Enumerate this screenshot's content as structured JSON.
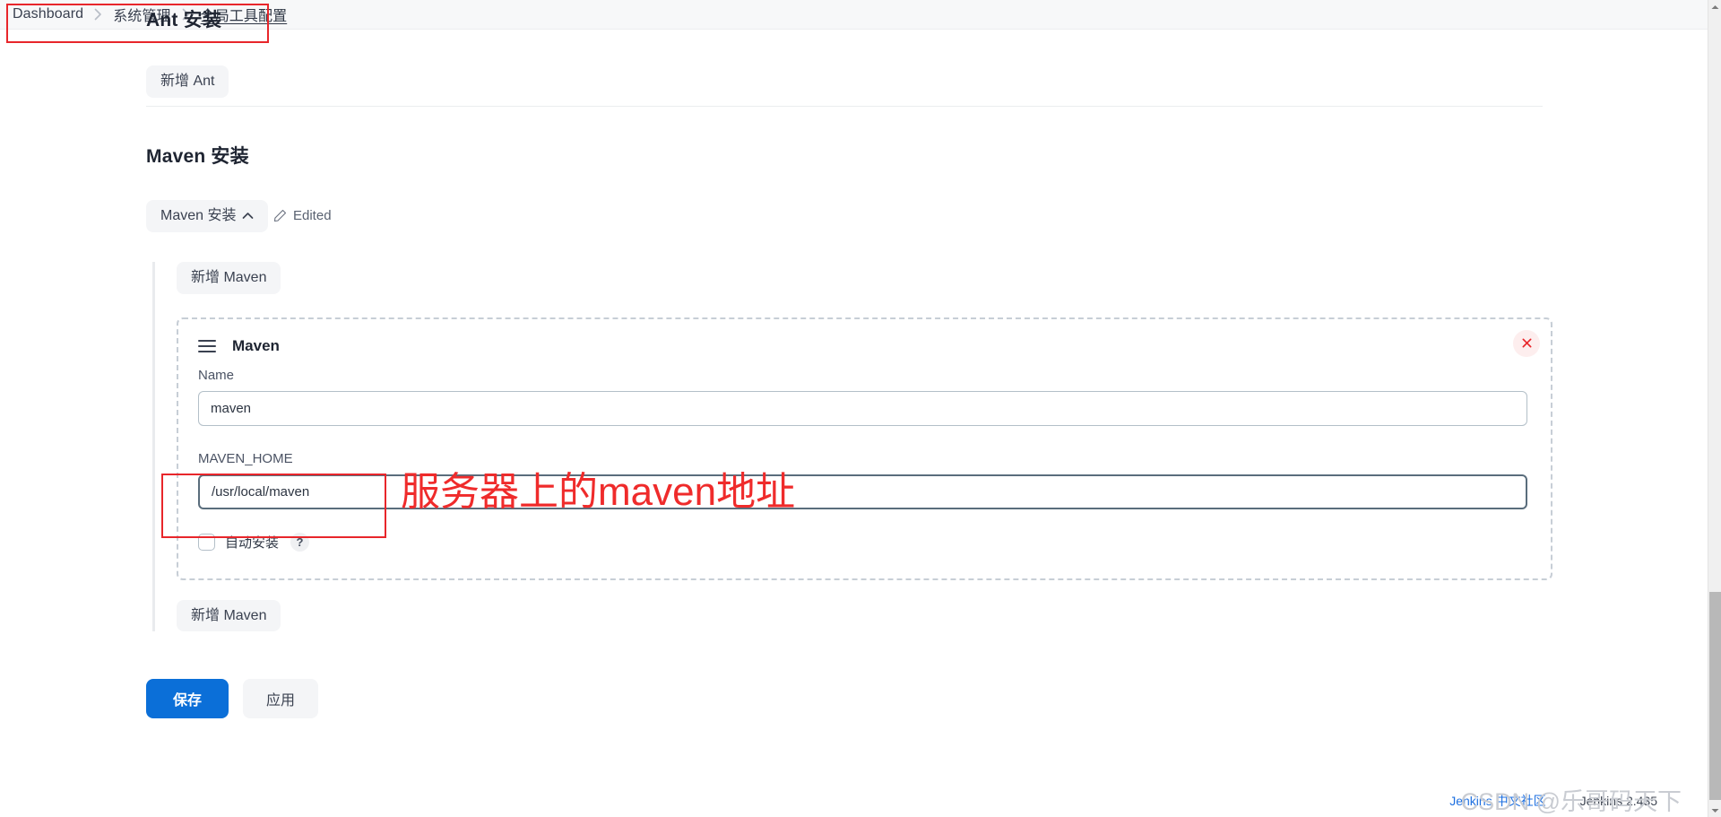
{
  "breadcrumb": {
    "items": [
      {
        "label": "Dashboard",
        "current": false
      },
      {
        "label": "系统管理",
        "current": false
      },
      {
        "label": "全局工具配置",
        "current": true
      }
    ],
    "separator_icon": "chevron-right-icon"
  },
  "ant_section": {
    "title": "Ant 安装",
    "add_button": "新增 Ant"
  },
  "maven_section": {
    "title": "Maven 安装",
    "collapse_chip": "Maven 安装",
    "collapse_icon": "chevron-up-icon",
    "edited_label": "Edited",
    "edited_icon": "pencil-icon",
    "add_button_top": "新增 Maven",
    "add_button_bottom": "新增 Maven",
    "card": {
      "drag_icon": "drag-handle-icon",
      "title": "Maven",
      "close_icon": "close-icon",
      "fields": [
        {
          "label": "Name",
          "value": "maven",
          "placeholder": "",
          "focused": false
        },
        {
          "label": "MAVEN_HOME",
          "value": "/usr/local/maven",
          "placeholder": "",
          "focused": true
        }
      ],
      "checkbox": {
        "label": "自动安装",
        "checked": false,
        "help_icon": "?"
      }
    }
  },
  "actions": {
    "save_label": "保存",
    "apply_label": "应用"
  },
  "footer": {
    "community_link": "Jenkins 中文社区",
    "version": "Jenkins 2.435",
    "watermark": "CSDN @乐哥码天下"
  },
  "annotations": {
    "maven_home_note": "服务器上的maven地址",
    "color": "#ef2b2b"
  },
  "colors": {
    "primary_button": "#0b6fd8",
    "annotation_red": "#e8262b",
    "link_blue": "#1d6fe0",
    "bar_background": "#f7f8f9"
  },
  "scrollbar": {
    "up_icon": "caret-up-icon",
    "down_icon": "caret-down-icon"
  }
}
